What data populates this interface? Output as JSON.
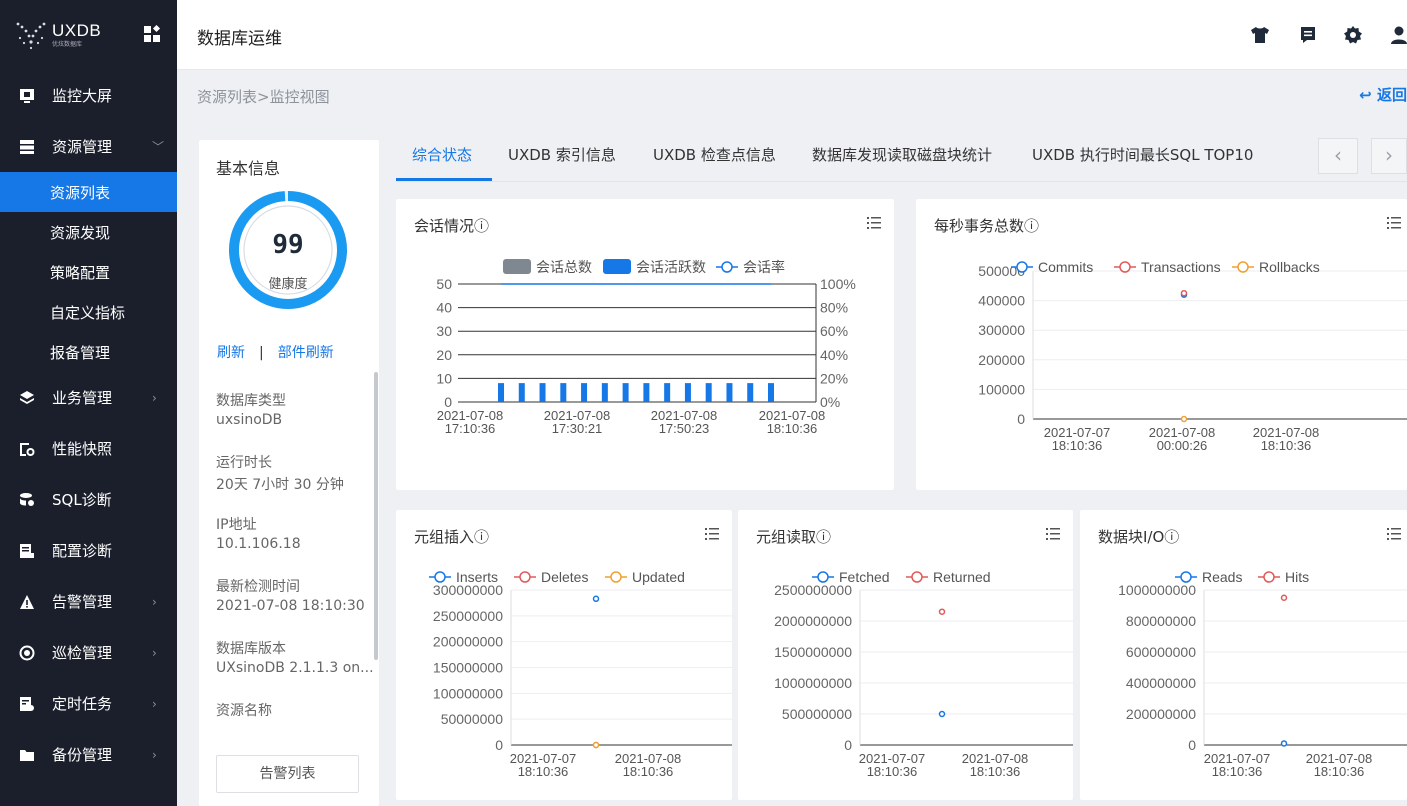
{
  "app": {
    "logo_text": "UXDB",
    "logo_sub": "优炫数据库"
  },
  "header": {
    "title": "数据库运维"
  },
  "sidebar": {
    "items": [
      {
        "label": "监控大屏",
        "icon": "monitor-icon"
      },
      {
        "label": "资源管理",
        "icon": "server-icon",
        "expanded": true
      },
      {
        "label": "业务管理",
        "icon": "layers-icon"
      },
      {
        "label": "性能快照",
        "icon": "snapshot-icon"
      },
      {
        "label": "SQL诊断",
        "icon": "database-icon"
      },
      {
        "label": "配置诊断",
        "icon": "config-icon"
      },
      {
        "label": "告警管理",
        "icon": "warning-icon"
      },
      {
        "label": "巡检管理",
        "icon": "inspect-icon"
      },
      {
        "label": "定时任务",
        "icon": "timer-icon"
      },
      {
        "label": "备份管理",
        "icon": "folder-icon"
      }
    ],
    "sub_items": [
      "资源列表",
      "资源发现",
      "策略配置",
      "自定义指标",
      "报备管理"
    ]
  },
  "breadcrumb": {
    "text": "资源列表>监控视图",
    "back": "返回"
  },
  "info": {
    "title": "基本信息",
    "health_score": "99",
    "health_fraction": 0.99,
    "health_label": "健康度",
    "refresh": "刷新",
    "sep": "|",
    "part_refresh": "部件刷新",
    "fields": [
      {
        "label": "数据库类型",
        "value": "uxsinoDB"
      },
      {
        "label": "运行时长",
        "value": "20天 7小时 30 分钟"
      },
      {
        "label": "IP地址",
        "value": "10.1.106.18"
      },
      {
        "label": "最新检测时间",
        "value": "2021-07-08 18:10:30"
      },
      {
        "label": "数据库版本",
        "value": "UXsinoDB 2.1.1.3 on..."
      },
      {
        "label": "资源名称",
        "value": ""
      }
    ],
    "alarm_btn": "告警列表"
  },
  "tabs": [
    {
      "label": "综合状态",
      "active": true
    },
    {
      "label": "UXDB 索引信息"
    },
    {
      "label": "UXDB 检查点信息"
    },
    {
      "label": "数据库发现读取磁盘块统计"
    },
    {
      "label": "UXDB 执行时间最长SQL TOP10"
    }
  ],
  "colors": {
    "primary": "#1677e6",
    "sidebar": "#1b1f2b",
    "gray_bar": "#7f8790",
    "red": "#e05a5a",
    "orange": "#f0a030"
  },
  "chart_data": [
    {
      "id": "sessions",
      "type": "bar",
      "title": "会话情况",
      "legend": [
        "会话总数",
        "会话活跃数",
        "会话率"
      ],
      "x_ticks": [
        "2021-07-08 17:10:36",
        "2021-07-08 17:30:21",
        "2021-07-08 17:50:23",
        "2021-07-08 18:10:36"
      ],
      "ylim": [
        0,
        50
      ],
      "y_ticks": [
        0,
        10,
        20,
        30,
        40,
        50
      ],
      "y2_ticks": [
        "0%",
        "20%",
        "40%",
        "60%",
        "80%",
        "100%"
      ],
      "series": [
        {
          "name": "会话总数",
          "values": [
            0,
            0,
            0,
            0,
            0,
            0,
            0,
            0,
            0,
            0,
            0,
            0,
            0,
            0
          ]
        },
        {
          "name": "会话活跃数",
          "values": [
            8,
            8,
            8,
            8,
            8,
            8,
            8,
            8,
            8,
            8,
            8,
            8,
            8,
            8
          ]
        },
        {
          "name": "会话率",
          "values": [
            100,
            100,
            100,
            100,
            100,
            100,
            100,
            100,
            100,
            100,
            100,
            100,
            100,
            100
          ]
        }
      ]
    },
    {
      "id": "tps",
      "type": "scatter",
      "title": "每秒事务总数",
      "legend": [
        "Commits",
        "Transactions",
        "Rollbacks"
      ],
      "x_ticks": [
        "2021-07-07 18:10:36",
        "2021-07-08 00:00:26",
        "2021-07-08 18:10:36"
      ],
      "ylim": [
        0,
        500000
      ],
      "y_ticks": [
        0,
        100000,
        200000,
        300000,
        400000,
        500000
      ],
      "series": [
        {
          "name": "Commits",
          "points": [
            [
              1,
              420000
            ]
          ]
        },
        {
          "name": "Transactions",
          "points": [
            [
              1,
              425000
            ]
          ]
        },
        {
          "name": "Rollbacks",
          "points": [
            [
              1,
              0
            ]
          ]
        }
      ]
    },
    {
      "id": "tuple_insert",
      "type": "scatter",
      "title": "元组插入",
      "legend": [
        "Inserts",
        "Deletes",
        "Updated"
      ],
      "x_ticks": [
        "2021-07-07 18:10:36",
        "2021-07-08 18:10:36"
      ],
      "ylim": [
        0,
        300000000
      ],
      "y_ticks": [
        0,
        50000000,
        100000000,
        150000000,
        200000000,
        250000000,
        300000000
      ],
      "series": [
        {
          "name": "Inserts",
          "points": [
            [
              0.5,
              283000000
            ]
          ]
        },
        {
          "name": "Deletes",
          "points": [
            [
              0.5,
              0
            ]
          ]
        },
        {
          "name": "Updated",
          "points": [
            [
              0.5,
              0
            ]
          ]
        }
      ]
    },
    {
      "id": "tuple_read",
      "type": "scatter",
      "title": "元组读取",
      "legend": [
        "Fetched",
        "Returned"
      ],
      "x_ticks": [
        "2021-07-07 18:10:36",
        "2021-07-08 18:10:36"
      ],
      "ylim": [
        0,
        2500000000
      ],
      "y_ticks": [
        0,
        500000000,
        1000000000,
        1500000000,
        2000000000,
        2500000000
      ],
      "series": [
        {
          "name": "Fetched",
          "points": [
            [
              0.5,
              500000000
            ]
          ]
        },
        {
          "name": "Returned",
          "points": [
            [
              0.5,
              2150000000
            ]
          ]
        }
      ]
    },
    {
      "id": "block_io",
      "type": "scatter",
      "title": "数据块I/O",
      "legend": [
        "Reads",
        "Hits"
      ],
      "x_ticks": [
        "2021-07-07 18:10:36",
        "2021-07-08 18:10:36"
      ],
      "ylim": [
        0,
        1000000000
      ],
      "y_ticks": [
        0,
        200000000,
        400000000,
        600000000,
        800000000,
        1000000000
      ],
      "series": [
        {
          "name": "Reads",
          "points": [
            [
              0.5,
              10000000
            ]
          ]
        },
        {
          "name": "Hits",
          "points": [
            [
              0.5,
              950000000
            ]
          ]
        }
      ]
    }
  ]
}
